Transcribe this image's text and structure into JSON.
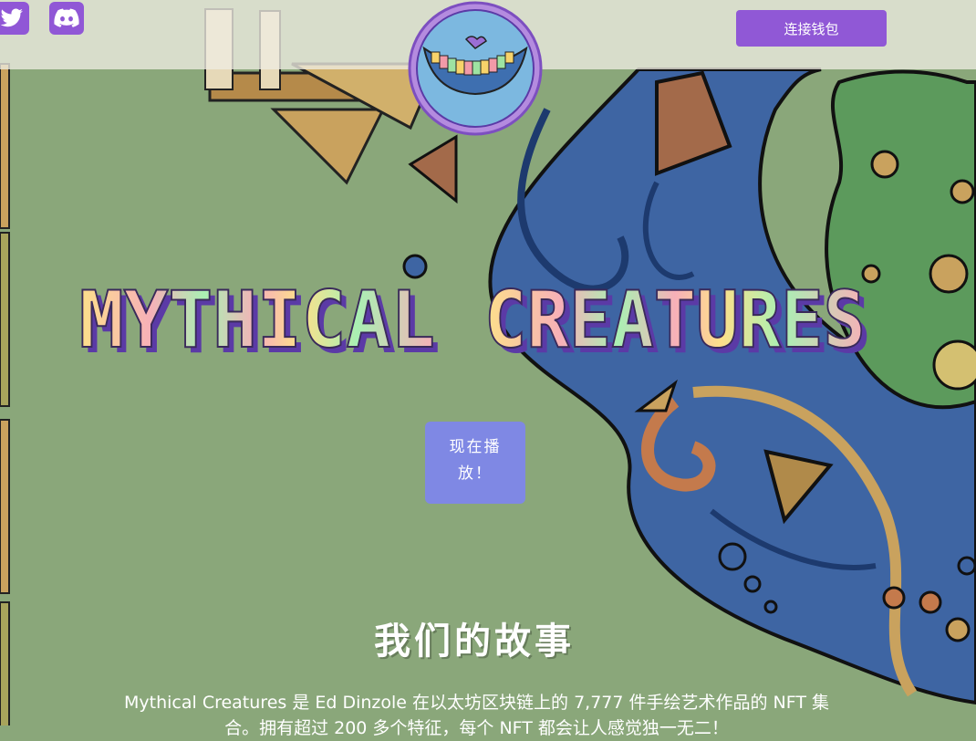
{
  "header": {
    "wallet_button_label": "连接钱包",
    "social": [
      {
        "name": "twitter-icon"
      },
      {
        "name": "discord-icon"
      }
    ]
  },
  "hero": {
    "title_lines": [
      "MYTHICAL",
      "CREATURES"
    ],
    "play_button_label": "现在播放！"
  },
  "story": {
    "title": "我们的故事",
    "text": "Mythical Creatures 是 Ed Dinzole 在以太坊区块链上的 7,777 件手绘艺术作品的 NFT 集合。拥有超过 200 多个特征，每个 NFT 都会让人感觉独一无二！"
  },
  "colors": {
    "accent_purple": "#9058d6",
    "play_button": "#7f88e4",
    "background_green": "#8aa77a",
    "title_yellow": "#fde08a",
    "title_green": "#a9f0b3",
    "title_pink": "#f7b0b8",
    "title_outline": "#5b3aa6"
  }
}
